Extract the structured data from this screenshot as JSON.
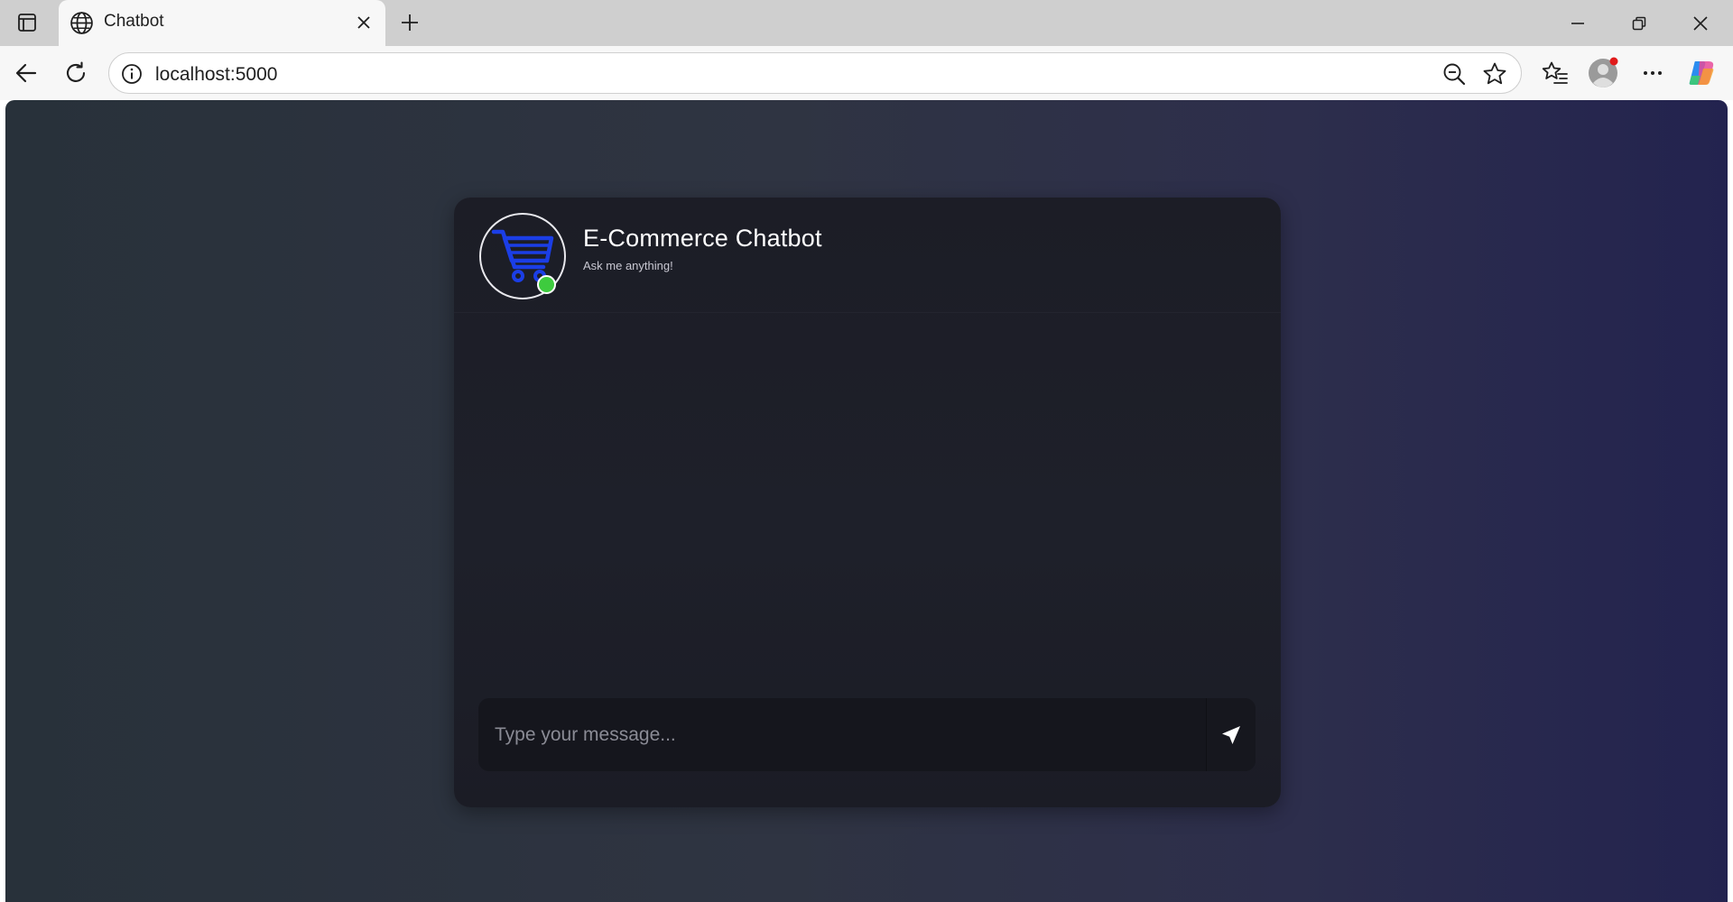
{
  "browser": {
    "tab": {
      "title": "Chatbot",
      "favicon": "globe-icon"
    },
    "address_bar": {
      "url": "localhost:5000"
    },
    "icons": {
      "tab_actions": "tab-actions-icon",
      "close_tab": "close-icon",
      "new_tab": "plus-icon",
      "minimize": "minimize-icon",
      "restore": "restore-icon",
      "close_window": "close-icon",
      "back": "back-arrow-icon",
      "refresh": "refresh-icon",
      "site_info": "info-icon",
      "zoom": "zoom-out-icon",
      "favorite": "star-icon",
      "favorites_list": "favorites-icon",
      "profile": "profile-avatar-icon",
      "more": "more-icon",
      "copilot": "copilot-icon"
    }
  },
  "chat": {
    "title": "E-Commerce Chatbot",
    "subtitle": "Ask me anything!",
    "avatar_icon": "shopping-cart-icon",
    "status": "online",
    "input": {
      "placeholder": "Type your message...",
      "value": ""
    },
    "send_icon": "send-icon"
  },
  "colors": {
    "cart_blue": "#1b3ee6",
    "online_green": "#3ecb3e",
    "profile_notification": "#e01b1b"
  }
}
